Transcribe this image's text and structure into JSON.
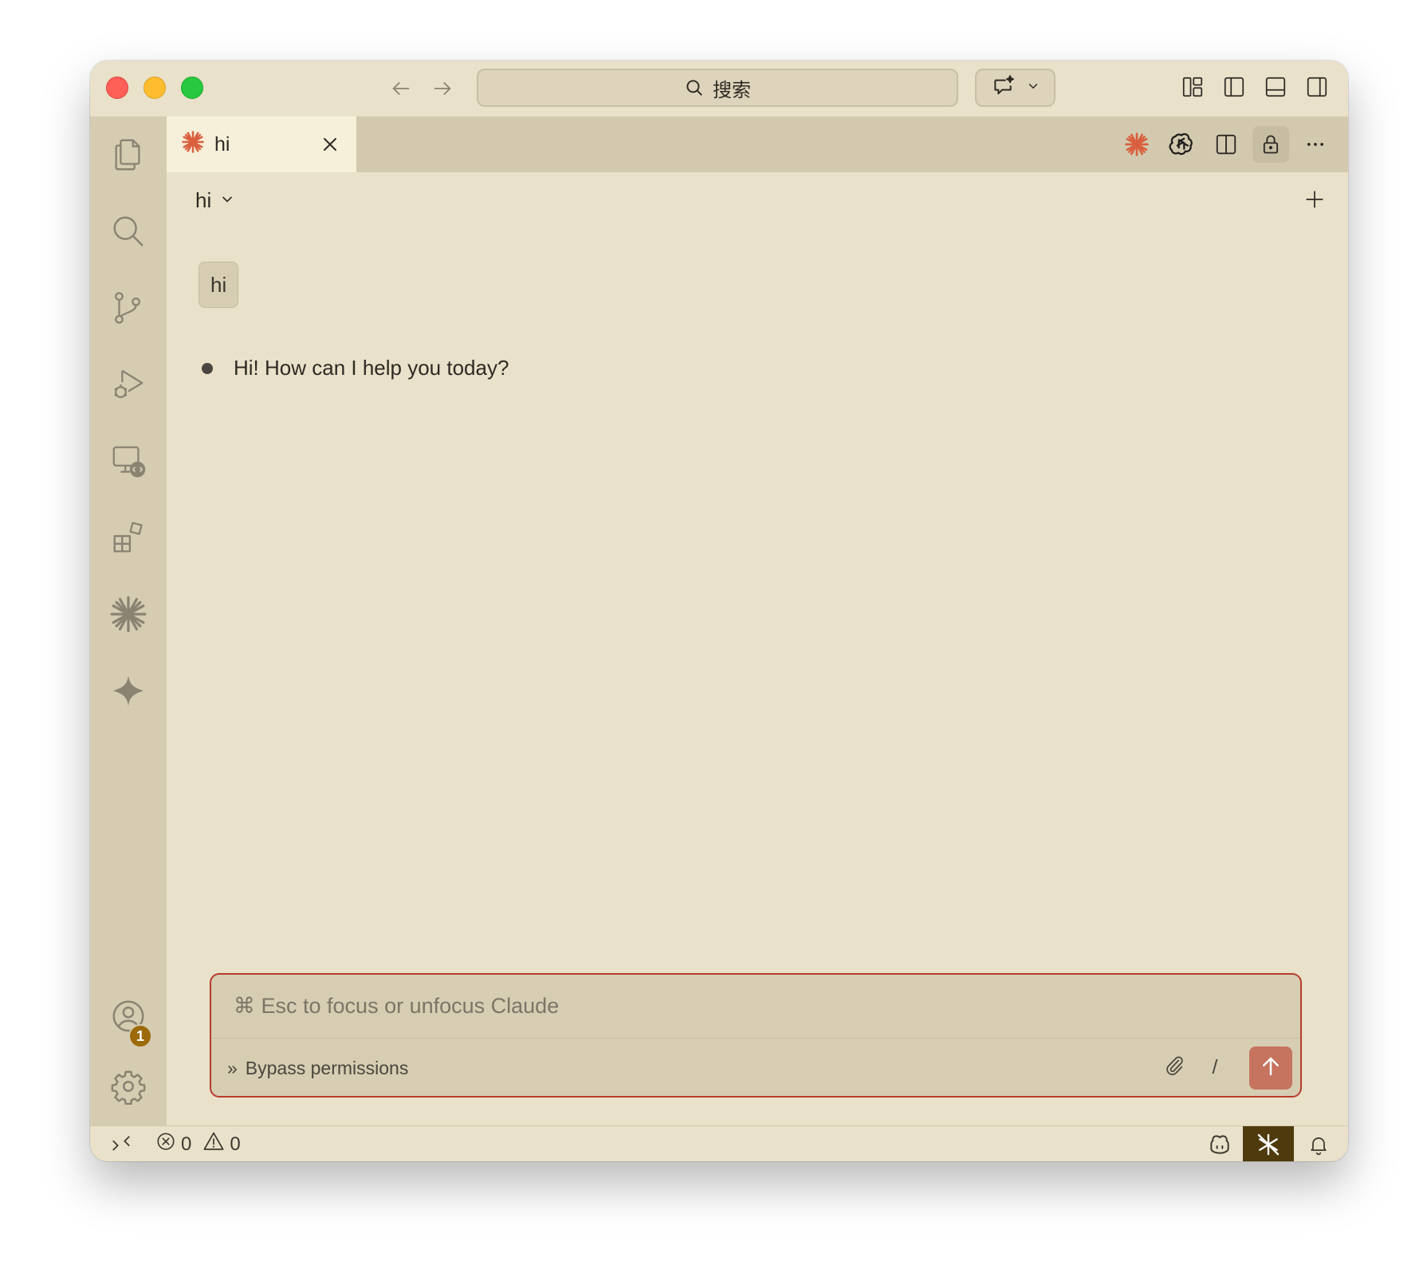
{
  "titlebar": {
    "search_placeholder": "搜索",
    "buttons": {
      "back": "back-arrow-icon",
      "forward": "forward-arrow-icon",
      "chat": "chat-sparkle-icon",
      "layout": [
        "customize-layout-icon",
        "toggle-primary-sidebar-icon",
        "toggle-panel-icon",
        "toggle-secondary-sidebar-icon"
      ]
    }
  },
  "activitybar": {
    "items": [
      "explorer-icon",
      "search-icon",
      "source-control-icon",
      "run-debug-icon",
      "remote-explorer-icon",
      "extensions-icon",
      "claude-icon",
      "sparkle-icon"
    ],
    "bottom": [
      "accounts-icon",
      "settings-icon"
    ],
    "accounts_badge": "1"
  },
  "tabs": [
    {
      "label": "hi",
      "icon": "claude-icon",
      "active": true
    }
  ],
  "tab_actions": [
    "claude-icon",
    "openai-icon",
    "split-editor-icon",
    "lock-icon",
    "more-icon"
  ],
  "chat": {
    "title": "hi",
    "messages": [
      {
        "role": "user",
        "text": "hi"
      },
      {
        "role": "assistant",
        "text": "Hi! How can I help you today?"
      }
    ],
    "input_placeholder": "⌘ Esc to focus or unfocus Claude",
    "mode_label": "Bypass permissions",
    "mode_prefix": "»",
    "slash_label": "/"
  },
  "statusbar": {
    "errors": "0",
    "warnings": "0"
  },
  "colors": {
    "background": "#e9e1c9",
    "activitybar": "#d5ccb2",
    "accent": "#d9603f",
    "input_border": "#b73b2e",
    "send_button": "#c6735f",
    "status_highlight": "#4e3a0c"
  }
}
